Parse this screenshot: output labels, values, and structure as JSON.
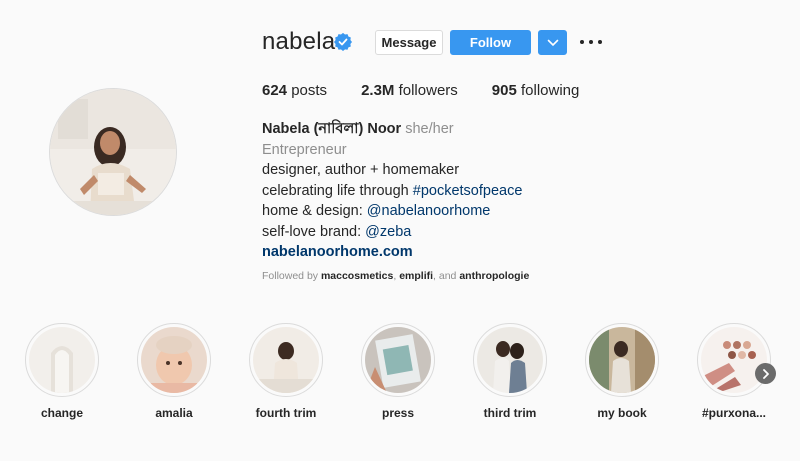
{
  "profile": {
    "username": "nabela",
    "verified": true,
    "buttons": {
      "message": "Message",
      "follow": "Follow"
    },
    "stats": {
      "posts_count": "624",
      "posts_label": "posts",
      "followers_count": "2.3M",
      "followers_label": "followers",
      "following_count": "905",
      "following_label": "following"
    },
    "bio": {
      "full_name": "Nabela (নাবিলা) Noor",
      "pronouns": "she/her",
      "category": "Entrepreneur",
      "line1": "designer, author + homemaker",
      "line2_text": "celebrating life through ",
      "line2_link": "#pocketsofpeace",
      "line3_text": "home & design: ",
      "line3_link": "@nabelanoorhome",
      "line4_text": "self-love brand: ",
      "line4_link": "@zeba",
      "website": "nabelanoorhome.com"
    },
    "followed_by": {
      "prefix": "Followed by ",
      "user1": "maccosmetics",
      "sep1": ", ",
      "user2": "emplifi",
      "sep2": ", and ",
      "user3": "anthropologie"
    }
  },
  "highlights": [
    {
      "label": "change"
    },
    {
      "label": "amalia"
    },
    {
      "label": "fourth trim"
    },
    {
      "label": "press"
    },
    {
      "label": "third trim"
    },
    {
      "label": "my book"
    },
    {
      "label": "#purxona..."
    }
  ],
  "icons": {
    "verified": "verified-badge-icon",
    "dropdown": "chevron-down-icon",
    "more": "more-options-icon",
    "next": "chevron-right-icon"
  },
  "colors": {
    "accent": "#3897f0",
    "link": "#00376b",
    "muted": "#8e8e8e",
    "text": "#262626"
  }
}
